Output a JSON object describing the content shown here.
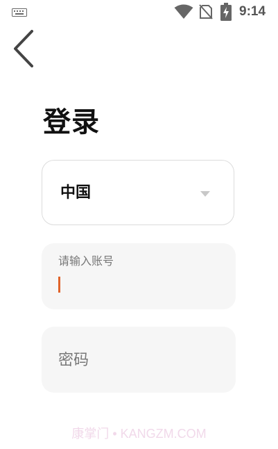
{
  "status_bar": {
    "time": "9:14",
    "icons": [
      "keyboard-icon",
      "wifi-icon",
      "no-sim-icon",
      "battery-charging-icon"
    ]
  },
  "header": {
    "back_icon": "chevron-left-icon"
  },
  "login": {
    "title": "登录",
    "country": {
      "value": "中国",
      "icon": "chevron-down-icon"
    },
    "account": {
      "label": "请输入账号",
      "value": ""
    },
    "password": {
      "placeholder": "密码",
      "value": ""
    }
  },
  "watermark": "康掌门 • KANGZM.COM",
  "colors": {
    "accent": "#e0632a",
    "field_bg": "#f6f6f6",
    "border": "#dcdcdc",
    "text": "#111111",
    "muted": "#777777"
  }
}
